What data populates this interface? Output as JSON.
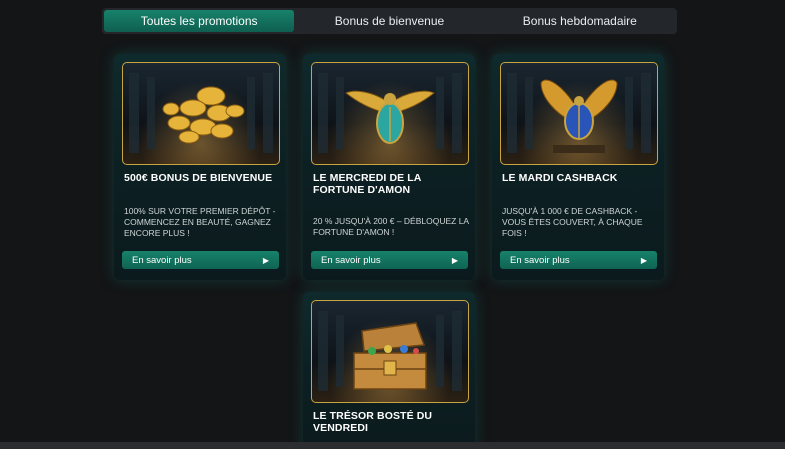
{
  "tabs": [
    {
      "label": "Toutes les promotions",
      "active": true
    },
    {
      "label": "Bonus de bienvenue",
      "active": false
    },
    {
      "label": "Bonus hebdomadaire",
      "active": false
    }
  ],
  "cards": [
    {
      "title": "500€ BONUS DE BIENVENUE",
      "description": "100% SUR VOTRE PREMIER DÉPÔT - COMMENCEZ EN BEAUTÉ, GAGNEZ ENCORE PLUS !",
      "button_label": "En savoir plus",
      "image": "gold-coins-icon"
    },
    {
      "title": "LE MERCREDI DE LA FORTUNE D'AMON",
      "description": "20 % JUSQU'À 200 € – DÉBLOQUEZ LA FORTUNE D'AMON !",
      "button_label": "En savoir plus",
      "image": "turquoise-scarab-icon"
    },
    {
      "title": "LE MARDI CASHBACK",
      "description": "JUSQU'À 1 000 € DE CASHBACK - VOUS ÊTES COUVERT, À CHAQUE FOIS !",
      "button_label": "En savoir plus",
      "image": "blue-winged-scarab-icon"
    },
    {
      "title": "LE TRÉSOR BOSTÉ DU VENDREDI",
      "description": "",
      "button_label": "",
      "image": "treasure-chest-icon"
    }
  ],
  "colors": {
    "accent": "#17826b",
    "gold": "#c9a441",
    "background": "#131517"
  }
}
